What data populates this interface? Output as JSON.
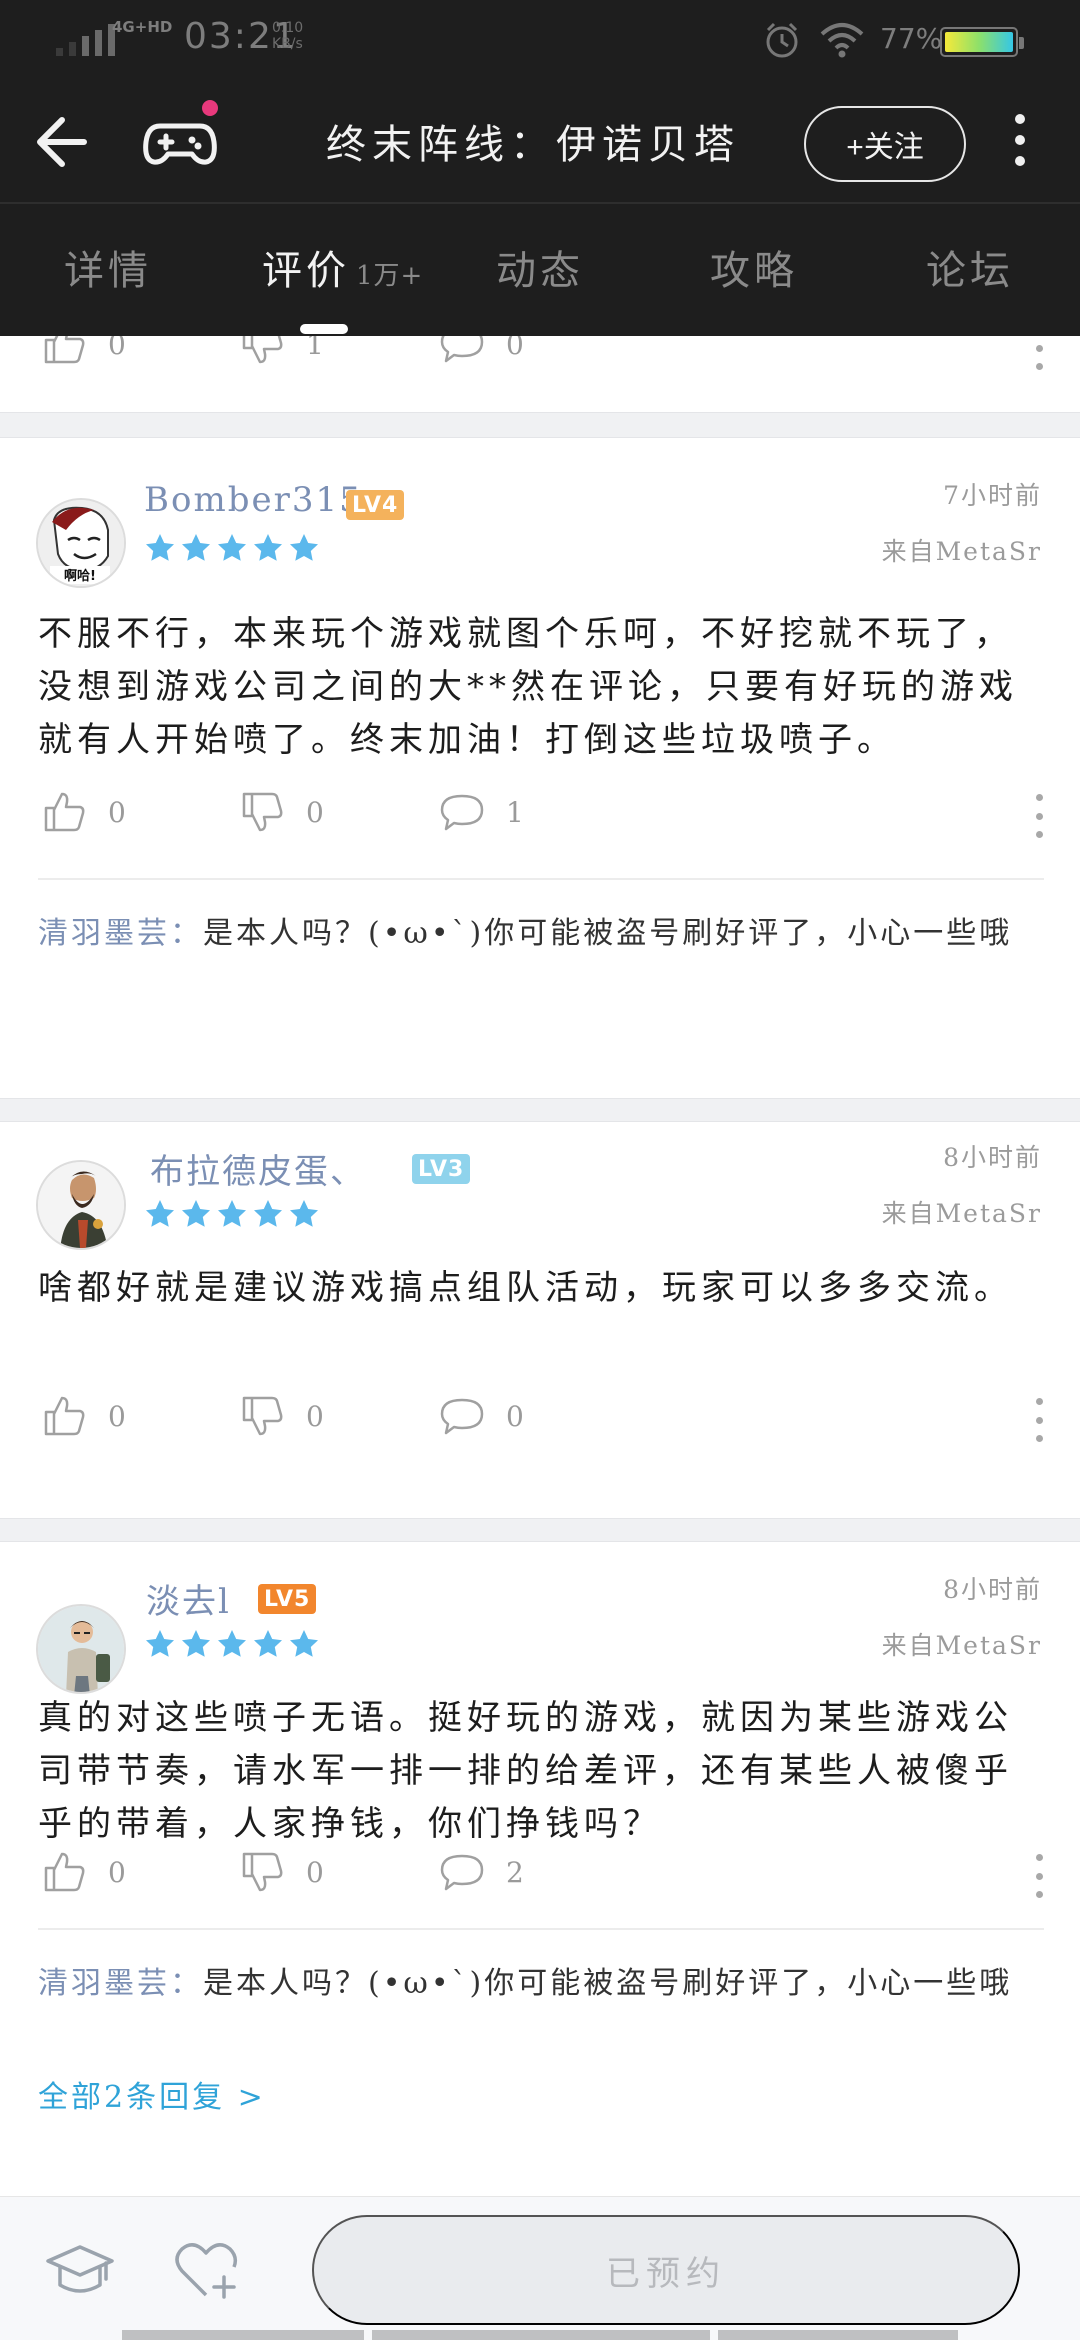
{
  "status_bar": {
    "network": "4G+HD",
    "time": "03:21",
    "speed_value": "0.10",
    "speed_unit": "KB/s",
    "battery": "77%"
  },
  "header": {
    "title": "终末阵线：伊诺贝塔",
    "follow_label": "+关注",
    "notification_dot_color": "#e8397c"
  },
  "tabs": [
    {
      "label": "详情",
      "active": false
    },
    {
      "label": "评价",
      "count": "1万+",
      "active": true
    },
    {
      "label": "动态",
      "active": false
    },
    {
      "label": "攻略",
      "active": false
    },
    {
      "label": "论坛",
      "active": false
    }
  ],
  "partial_review": {
    "likes": "0",
    "dislikes": "1",
    "comments": "0"
  },
  "reviews": [
    {
      "username": "Bomber315",
      "level": "LV4",
      "stars": 5,
      "time": "7小时前",
      "source": "来自MetaSr",
      "text": "不服不行，本来玩个游戏就图个乐呵，不好挖就不玩了，没想到游戏公司之间的大**然在评论，只要有好玩的游戏就有人开始喷了。终末加油！打倒这些垃圾喷子。",
      "likes": "0",
      "dislikes": "0",
      "comments": "1",
      "reply": {
        "author": "清羽墨芸：",
        "text": "是本人吗？(•ω•`)你可能被盗号刷好评了，小心一些哦"
      }
    },
    {
      "username": "布拉德皮蛋、",
      "level": "LV3",
      "stars": 5,
      "time": "8小时前",
      "source": "来自MetaSr",
      "text": "啥都好就是建议游戏搞点组队活动，玩家可以多多交流。",
      "likes": "0",
      "dislikes": "0",
      "comments": "0"
    },
    {
      "username": "淡去l",
      "level": "LV5",
      "stars": 5,
      "time": "8小时前",
      "source": "来自MetaSr",
      "text": "真的对这些喷子无语。挺好玩的游戏，就因为某些游戏公司带节奏，请水军一排一排的给差评，还有某些人被傻乎乎的带着，人家挣钱，你们挣钱吗？",
      "likes": "0",
      "dislikes": "0",
      "comments": "2",
      "reply": {
        "author": "清羽墨芸：",
        "text": "是本人吗？(•ω•`)你可能被盗号刷好评了，小心一些哦"
      },
      "all_replies": "全部2条回复 >"
    }
  ],
  "bottom_bar": {
    "reserved_label": "已预约"
  },
  "colors": {
    "header_bg": "#1e1e1e",
    "star": "#5bb8ec",
    "username": "#7b8fb4",
    "link": "#2fa3d8"
  }
}
